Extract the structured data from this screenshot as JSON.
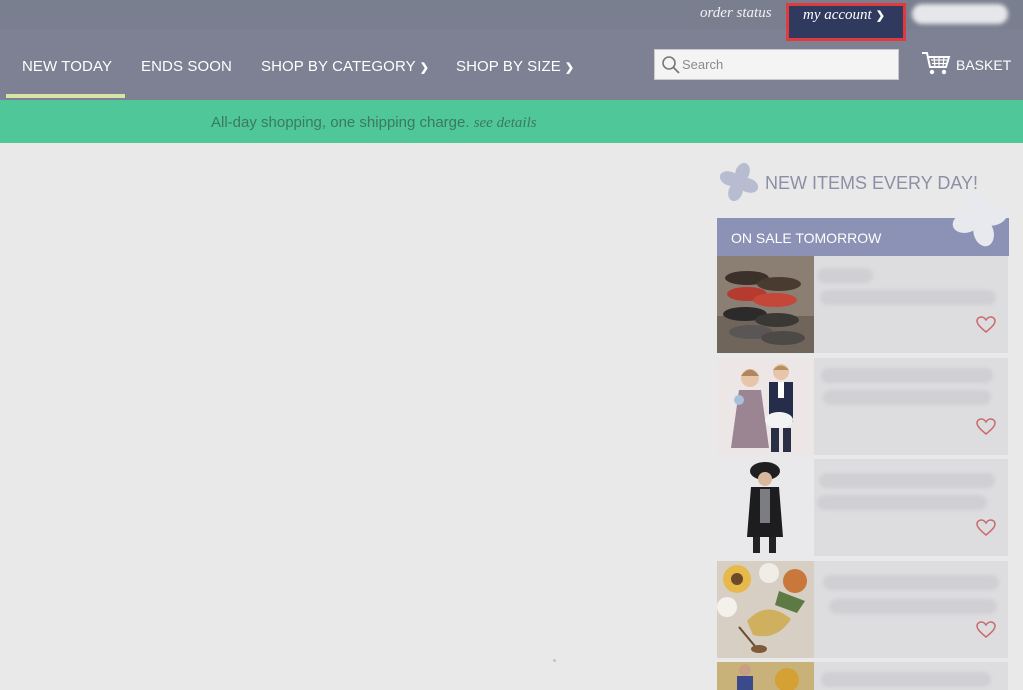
{
  "topbar": {
    "order_status": "order status",
    "my_account": "my account"
  },
  "nav": {
    "items": [
      {
        "label": "NEW TODAY"
      },
      {
        "label": "ENDS SOON"
      },
      {
        "label": "SHOP BY CATEGORY"
      },
      {
        "label": "SHOP BY SIZE"
      }
    ],
    "search_placeholder": "Search",
    "basket": "BASKET"
  },
  "promo": {
    "text": "All-day shopping, one shipping charge.",
    "link": "see details"
  },
  "sidebar": {
    "title": "NEW ITEMS EVERY DAY!",
    "section": "ON SALE TOMORROW"
  },
  "colors": {
    "nav_bg": "#7d8193",
    "promo_bg": "#4fc799",
    "account_bg": "#2f3a5e",
    "highlight": "#e03a3e",
    "sale_header": "#8c92b5"
  }
}
